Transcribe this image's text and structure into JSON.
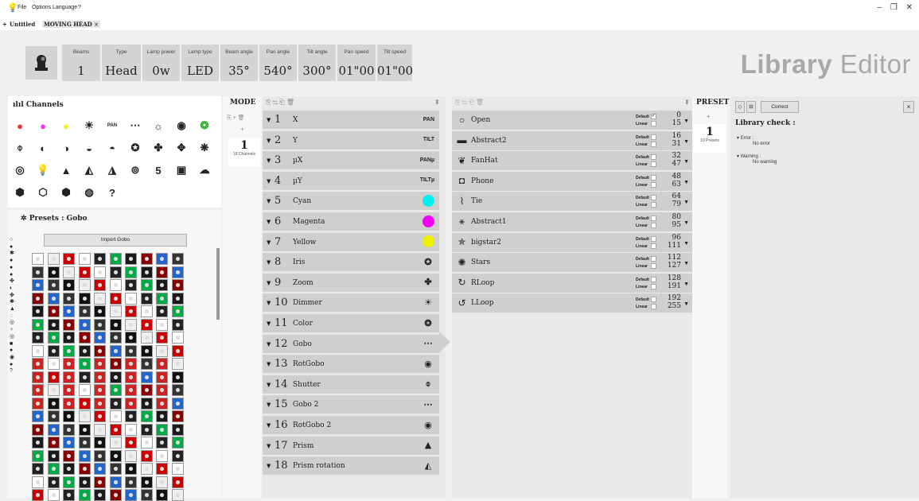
{
  "menu": {
    "file": "File",
    "options": "Options",
    "language": "Language",
    "help": "?"
  },
  "window": {
    "minimize": "–",
    "maximize": "❐",
    "close": "✕"
  },
  "tabs": {
    "new": "+",
    "untitled": "Untitled",
    "moving_head": "MOVING HEAD",
    "close": "×"
  },
  "fixture": {
    "props": [
      {
        "label": "Beams",
        "value": "1"
      },
      {
        "label": "Type",
        "value": "Head"
      },
      {
        "label": "Lamp power",
        "value": "0w"
      },
      {
        "label": "Lamp type",
        "value": "LED"
      },
      {
        "label": "Beam angle",
        "value": "35°"
      },
      {
        "label": "Pan angle",
        "value": "540°"
      },
      {
        "label": "Tilt angle",
        "value": "300°"
      },
      {
        "label": "Pan speed",
        "value": "01\"00"
      },
      {
        "label": "Tilt speed",
        "value": "01\"00"
      }
    ]
  },
  "title": {
    "bold": "Library",
    "light": " Editor"
  },
  "channels_panel": {
    "title": "Channels",
    "icons": [
      {
        "name": "rgb-icon",
        "glyph": "●",
        "color": "#e33"
      },
      {
        "name": "cmy-icon",
        "glyph": "●",
        "color": "#e3e"
      },
      {
        "name": "color-wheel-icon",
        "glyph": "●",
        "color": "#ee3"
      },
      {
        "name": "dimmer-icon",
        "glyph": "☀",
        "color": "#222"
      },
      {
        "name": "pan-tilt-icon",
        "glyph": "PAN",
        "color": "#222"
      },
      {
        "name": "beam-icon",
        "glyph": "⋯",
        "color": "#222"
      },
      {
        "name": "strobe-icon",
        "glyph": "☼",
        "color": "#222"
      },
      {
        "name": "gobo-wheel-icon",
        "glyph": "◉",
        "color": "#222"
      },
      {
        "name": "effect-icon",
        "glyph": "❂",
        "color": "#2a2"
      },
      {
        "name": "shutter-icon",
        "glyph": "⌽",
        "color": "#222"
      },
      {
        "name": "rotgobo-icon",
        "glyph": "◐",
        "color": "#222"
      },
      {
        "name": "gobo2-icon",
        "glyph": "◑",
        "color": "#222"
      },
      {
        "name": "gobo3-icon",
        "glyph": "◒",
        "color": "#222"
      },
      {
        "name": "gobo4-icon",
        "glyph": "◓",
        "color": "#222"
      },
      {
        "name": "iris-icon",
        "glyph": "✪",
        "color": "#222"
      },
      {
        "name": "zoom-icon",
        "glyph": "✤",
        "color": "#222"
      },
      {
        "name": "focus-icon",
        "glyph": "✥",
        "color": "#222"
      },
      {
        "name": "frost-icon",
        "glyph": "❋",
        "color": "#222"
      },
      {
        "name": "speed-icon",
        "glyph": "◎",
        "color": "#222"
      },
      {
        "name": "lamp-icon",
        "glyph": "💡",
        "color": "#222"
      },
      {
        "name": "prism-icon",
        "glyph": "▲",
        "color": "#222"
      },
      {
        "name": "prism-rotation-icon",
        "glyph": "◭",
        "color": "#222"
      },
      {
        "name": "prism2-icon",
        "glyph": "◮",
        "color": "#222"
      },
      {
        "name": "reset-icon",
        "glyph": "⊚",
        "color": "#222"
      },
      {
        "name": "macro-icon",
        "glyph": "5",
        "color": "#222"
      },
      {
        "name": "fan-icon",
        "glyph": "▣",
        "color": "#222"
      },
      {
        "name": "smoke-icon",
        "glyph": "☁",
        "color": "#222"
      },
      {
        "name": "animation-icon",
        "glyph": "⬢",
        "color": "#222"
      },
      {
        "name": "effect2-icon",
        "glyph": "⬡",
        "color": "#222"
      },
      {
        "name": "effect3-icon",
        "glyph": "⬢",
        "color": "#222"
      },
      {
        "name": "effect4-icon",
        "glyph": "◍",
        "color": "#222"
      },
      {
        "name": "unknown-icon",
        "glyph": "?",
        "color": "#222"
      }
    ]
  },
  "presets_panel": {
    "title": "Presets : Gobo",
    "import_label": "Import Gobo",
    "side_icons": [
      "○",
      "●",
      "✱",
      "●",
      "●",
      "●",
      "✤",
      "◐",
      "✤",
      "✱",
      "▲",
      "◌",
      "◎",
      "♀",
      "◎",
      "■",
      "●",
      "◉",
      "●",
      "?"
    ]
  },
  "mode": {
    "label": "MODE",
    "add": "+",
    "count": "1",
    "sub": "18 Channels"
  },
  "channels": [
    {
      "num": "1",
      "name": "X",
      "tag": "PAN"
    },
    {
      "num": "2",
      "name": "Y",
      "tag": "TILT"
    },
    {
      "num": "3",
      "name": "µX",
      "tag": "PANµ"
    },
    {
      "num": "4",
      "name": "µY",
      "tag": "TILTµ"
    },
    {
      "num": "5",
      "name": "Cyan",
      "color": "#00f0f0"
    },
    {
      "num": "6",
      "name": "Magenta",
      "color": "#f000f0"
    },
    {
      "num": "7",
      "name": "Yellow",
      "color": "#f0f000"
    },
    {
      "num": "8",
      "name": "Iris",
      "glyph": "✪"
    },
    {
      "num": "9",
      "name": "Zoom",
      "glyph": "✤"
    },
    {
      "num": "10",
      "name": "Dimmer",
      "glyph": "☀"
    },
    {
      "num": "11",
      "name": "Color",
      "glyph": "❂"
    },
    {
      "num": "12",
      "name": "Gobo",
      "glyph": "⋯"
    },
    {
      "num": "13",
      "name": "RotGobo",
      "glyph": "◉"
    },
    {
      "num": "14",
      "name": "Shutter",
      "glyph": "⌽"
    },
    {
      "num": "15",
      "name": "Gobo 2",
      "glyph": "⋯"
    },
    {
      "num": "16",
      "name": "RotGobo 2",
      "glyph": "◉"
    },
    {
      "num": "17",
      "name": "Prism",
      "glyph": "▲"
    },
    {
      "num": "18",
      "name": "Prism rotation",
      "glyph": "◭"
    }
  ],
  "preset": {
    "label": "PRESET",
    "add": "+",
    "count": "1",
    "sub": "10 Presets"
  },
  "presets": [
    {
      "name": "Open",
      "glyph": "○",
      "default": "Default",
      "linear": "Linear",
      "v1": "0",
      "v2": "15",
      "checked": "✓"
    },
    {
      "name": "Abstract2",
      "glyph": "▬",
      "default": "Default",
      "linear": "Linear",
      "v1": "16",
      "v2": "31",
      "checked": ""
    },
    {
      "name": "FanHat",
      "glyph": "❦",
      "default": "Default",
      "linear": "Linear",
      "v1": "32",
      "v2": "47",
      "checked": ""
    },
    {
      "name": "Phone",
      "glyph": "◘",
      "default": "Default",
      "linear": "Linear",
      "v1": "48",
      "v2": "63",
      "checked": ""
    },
    {
      "name": "Tie",
      "glyph": "⌇",
      "default": "Default",
      "linear": "Linear",
      "v1": "64",
      "v2": "79",
      "checked": ""
    },
    {
      "name": "Abstract1",
      "glyph": "⚹",
      "default": "Default",
      "linear": "Linear",
      "v1": "80",
      "v2": "95",
      "checked": ""
    },
    {
      "name": "bigstar2",
      "glyph": "✯",
      "default": "Default",
      "linear": "Linear",
      "v1": "96",
      "v2": "111",
      "checked": ""
    },
    {
      "name": "Stars",
      "glyph": "✺",
      "default": "Default",
      "linear": "Linear",
      "v1": "112",
      "v2": "127",
      "checked": ""
    },
    {
      "name": "RLoop",
      "glyph": "↻",
      "default": "Default",
      "linear": "Linear",
      "v1": "128",
      "v2": "191",
      "checked": ""
    },
    {
      "name": "LLoop",
      "glyph": "↺",
      "default": "Default",
      "linear": "Linear",
      "v1": "192",
      "v2": "255",
      "checked": ""
    }
  ],
  "check": {
    "correct_label": "Correct",
    "close": "×",
    "title": "Library check :",
    "error_label": "Error :",
    "error_value": "No error",
    "warning_label": "Warning :",
    "warning_value": "No warning"
  }
}
